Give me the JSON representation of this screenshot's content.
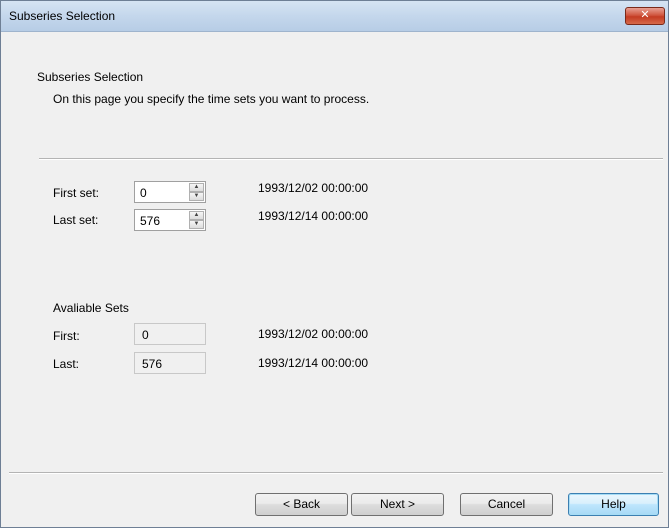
{
  "window": {
    "title": "Subseries Selection",
    "close_glyph": "✕"
  },
  "header": {
    "title": "Subseries Selection",
    "description": "On this page you specify the time sets you want to process."
  },
  "selection": {
    "first_label": "First set:",
    "first_value": "0",
    "first_date": "1993/12/02 00:00:00",
    "last_label": "Last set:",
    "last_value": "576",
    "last_date": "1993/12/14 00:00:00"
  },
  "available": {
    "title": "Avaliable Sets",
    "first_label": "First:",
    "first_value": "0",
    "first_date": "1993/12/02 00:00:00",
    "last_label": "Last:",
    "last_value": "576",
    "last_date": "1993/12/14 00:00:00"
  },
  "buttons": {
    "back": "< Back",
    "next": "Next >",
    "cancel": "Cancel",
    "help": "Help"
  },
  "icons": {
    "spin_up": "▲",
    "spin_down": "▼"
  }
}
